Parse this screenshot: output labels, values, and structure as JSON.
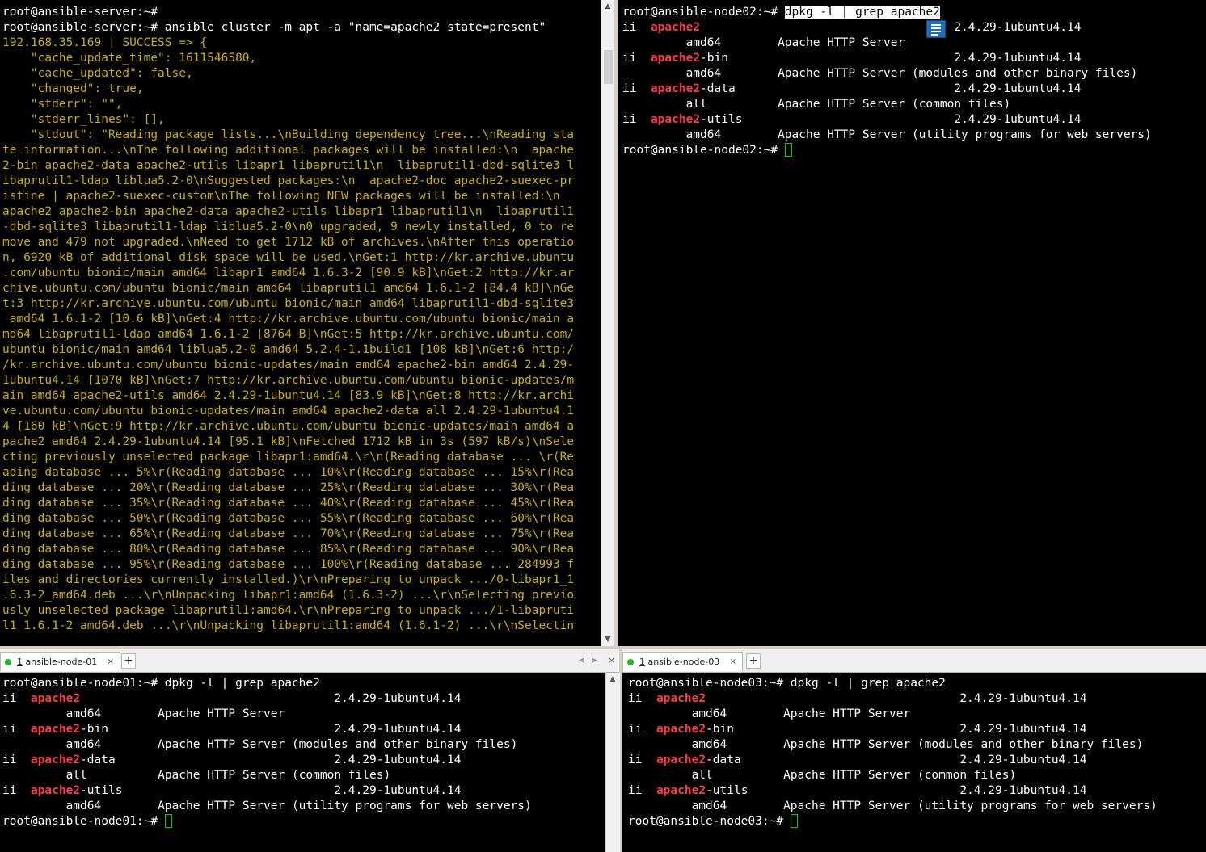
{
  "panes": {
    "server": {
      "lines": [
        "root@ansible-server:~#",
        "root@ansible-server:~# ansible cluster -m apt -a \"name=apache2 state=present\""
      ],
      "output": [
        "192.168.35.169 | SUCCESS => {",
        "    \"cache_update_time\": 1611546580,",
        "    \"cache_updated\": false,",
        "    \"changed\": true,",
        "    \"stderr\": \"\",",
        "    \"stderr_lines\": [],",
        "    \"stdout\": \"Reading package lists...\\nBuilding dependency tree...\\nReading sta",
        "te information...\\nThe following additional packages will be installed:\\n  apache",
        "2-bin apache2-data apache2-utils libapr1 libaprutil1\\n  libaprutil1-dbd-sqlite3 l",
        "ibaprutil1-ldap liblua5.2-0\\nSuggested packages:\\n  apache2-doc apache2-suexec-pr",
        "istine | apache2-suexec-custom\\nThe following NEW packages will be installed:\\n",
        "apache2 apache2-bin apache2-data apache2-utils libapr1 libaprutil1\\n  libaprutil1",
        "-dbd-sqlite3 libaprutil1-ldap liblua5.2-0\\n0 upgraded, 9 newly installed, 0 to re",
        "move and 479 not upgraded.\\nNeed to get 1712 kB of archives.\\nAfter this operatio",
        "n, 6920 kB of additional disk space will be used.\\nGet:1 http://kr.archive.ubuntu",
        ".com/ubuntu bionic/main amd64 libapr1 amd64 1.6.3-2 [90.9 kB]\\nGet:2 http://kr.ar",
        "chive.ubuntu.com/ubuntu bionic/main amd64 libaprutil1 amd64 1.6.1-2 [84.4 kB]\\nGe",
        "t:3 http://kr.archive.ubuntu.com/ubuntu bionic/main amd64 libaprutil1-dbd-sqlite3",
        " amd64 1.6.1-2 [10.6 kB]\\nGet:4 http://kr.archive.ubuntu.com/ubuntu bionic/main a",
        "md64 libaprutil1-ldap amd64 1.6.1-2 [8764 B]\\nGet:5 http://kr.archive.ubuntu.com/",
        "ubuntu bionic/main amd64 liblua5.2-0 amd64 5.2.4-1.1build1 [108 kB]\\nGet:6 http:/",
        "/kr.archive.ubuntu.com/ubuntu bionic-updates/main amd64 apache2-bin amd64 2.4.29-",
        "1ubuntu4.14 [1070 kB]\\nGet:7 http://kr.archive.ubuntu.com/ubuntu bionic-updates/m",
        "ain amd64 apache2-utils amd64 2.4.29-1ubuntu4.14 [83.9 kB]\\nGet:8 http://kr.archi",
        "ve.ubuntu.com/ubuntu bionic-updates/main amd64 apache2-data all 2.4.29-1ubuntu4.1",
        "4 [160 kB]\\nGet:9 http://kr.archive.ubuntu.com/ubuntu bionic-updates/main amd64 a",
        "pache2 amd64 2.4.29-1ubuntu4.14 [95.1 kB]\\nFetched 1712 kB in 3s (597 kB/s)\\nSele",
        "cting previously unselected package libapr1:amd64.\\r\\n(Reading database ... \\r(Re",
        "ading database ... 5%\\r(Reading database ... 10%\\r(Reading database ... 15%\\r(Rea",
        "ding database ... 20%\\r(Reading database ... 25%\\r(Reading database ... 30%\\r(Rea",
        "ding database ... 35%\\r(Reading database ... 40%\\r(Reading database ... 45%\\r(Rea",
        "ding database ... 50%\\r(Reading database ... 55%\\r(Reading database ... 60%\\r(Rea",
        "ding database ... 65%\\r(Reading database ... 70%\\r(Reading database ... 75%\\r(Rea",
        "ding database ... 80%\\r(Reading database ... 85%\\r(Reading database ... 90%\\r(Rea",
        "ding database ... 95%\\r(Reading database ... 100%\\r(Reading database ... 284993 f",
        "iles and directories currently installed.)\\r\\nPreparing to unpack .../0-libapr1_1",
        ".6.3-2_amd64.deb ...\\r\\nUnpacking libapr1:amd64 (1.6.3-2) ...\\r\\nSelecting previo",
        "usly unselected package libaprutil1:amd64.\\r\\nPreparing to unpack .../1-libapruti",
        "l1_1.6.1-2_amd64.deb ...\\r\\nUnpacking libaprutil1:amd64 (1.6.1-2) ...\\r\\nSelectin"
      ]
    },
    "node02": {
      "prompt": "root@ansible-node02:~# ",
      "command": "dpkg -l | grep apache2"
    },
    "node01": {
      "prompt": "root@ansible-node01:~# ",
      "command": "dpkg -l | grep apache2"
    },
    "node03": {
      "prompt": "root@ansible-node03:~# ",
      "command": "dpkg -l | grep apache2"
    }
  },
  "packages": [
    {
      "status": "ii",
      "name_red": "apache2",
      "name_suffix": "",
      "version": "2.4.29-1ubuntu4.14",
      "arch": "amd64",
      "desc": "Apache HTTP Server"
    },
    {
      "status": "ii",
      "name_red": "apache2",
      "name_suffix": "-bin",
      "version": "2.4.29-1ubuntu4.14",
      "arch": "amd64",
      "desc": "Apache HTTP Server (modules and other binary files)"
    },
    {
      "status": "ii",
      "name_red": "apache2",
      "name_suffix": "-data",
      "version": "2.4.29-1ubuntu4.14",
      "arch": "all",
      "desc": "Apache HTTP Server (common files)"
    },
    {
      "status": "ii",
      "name_red": "apache2",
      "name_suffix": "-utils",
      "version": "2.4.29-1ubuntu4.14",
      "arch": "amd64",
      "desc": "Apache HTTP Server (utility programs for web servers)"
    }
  ],
  "tabs": {
    "left": {
      "number": "1",
      "label": " ansible-node-01",
      "close": "×"
    },
    "right": {
      "number": "1",
      "label": " ansible-node-03",
      "close": "×"
    },
    "add": "+",
    "nav_prev": "◀",
    "nav_next": "▶"
  },
  "scrollbar": {
    "up": "▲",
    "down": "▼"
  },
  "colors": {
    "status_ok": "#1fb81f",
    "highlight": "#ff3b4b",
    "output_yellow": "#c9b000"
  },
  "icons": {
    "note": "note-icon"
  }
}
